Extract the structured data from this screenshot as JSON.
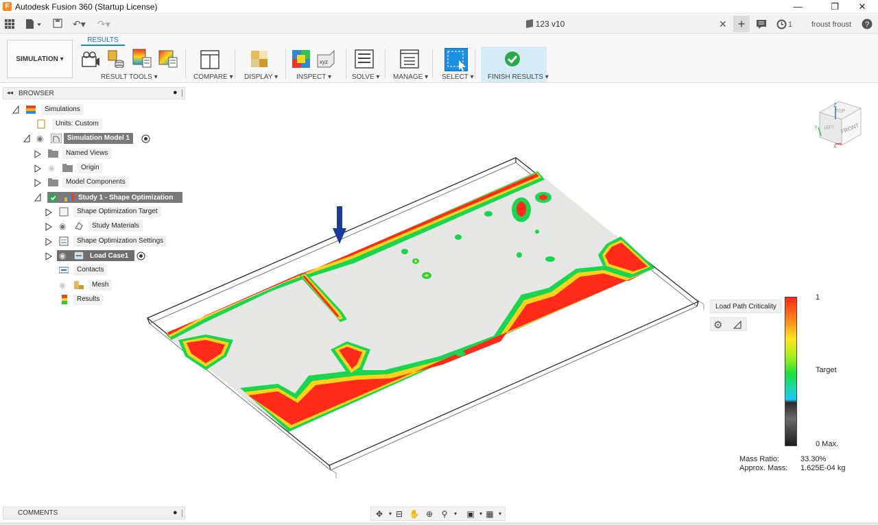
{
  "window": {
    "title": "Autodesk Fusion 360 (Startup License)",
    "controls": {
      "minimize": "—",
      "maximize": "❐",
      "close": "✕"
    }
  },
  "quick_access": {
    "document_tab": "123 v10",
    "job_count": "1",
    "user_name": "froust froust"
  },
  "ribbon": {
    "active_tab": "RESULTS",
    "workspace": "SIMULATION ▾",
    "groups": {
      "result_tools": "RESULT TOOLS ▾",
      "compare": "COMPARE ▾",
      "display": "DISPLAY ▾",
      "inspect": "INSPECT ▾",
      "solve": "SOLVE ▾",
      "manage": "MANAGE ▾",
      "select": "SELECT ▾",
      "finish": "FINISH RESULTS ▾"
    },
    "inspect_xyz": "xyz"
  },
  "browser": {
    "header": "BROWSER",
    "items": [
      {
        "label": "Simulations"
      },
      {
        "label": "Units: Custom"
      },
      {
        "label": "Simulation Model 1"
      },
      {
        "label": "Named Views"
      },
      {
        "label": "Origin"
      },
      {
        "label": "Model Components"
      },
      {
        "label": "Study 1 - Shape Optimization"
      },
      {
        "label": "Shape Optimization Target"
      },
      {
        "label": "Study Materials"
      },
      {
        "label": "Shape Optimization Settings"
      },
      {
        "label": "Load Case1"
      },
      {
        "label": "Contacts"
      },
      {
        "label": "Mesh"
      },
      {
        "label": "Results"
      }
    ]
  },
  "comments": {
    "header": "COMMENTS"
  },
  "viewcube": {
    "top": "TOP",
    "front": "FRONT",
    "left": "LEFT",
    "z": "Z",
    "x": "X",
    "y": "Y"
  },
  "legend": {
    "result_type": "Load Path Criticality ▾",
    "max_label": "1",
    "target_label": "Target",
    "min_label": "0 Max.",
    "colors": {
      "high": "#ff2a1a",
      "target": "#18e03a",
      "low": "#1d1d1d"
    }
  },
  "mass_info": {
    "ratio_label": "Mass Ratio:",
    "ratio_value": "33.30%",
    "mass_label": "Approx. Mass:",
    "mass_value": "1.625E-04 kg"
  },
  "load_arrow": {
    "color": "#1a3a9c"
  }
}
